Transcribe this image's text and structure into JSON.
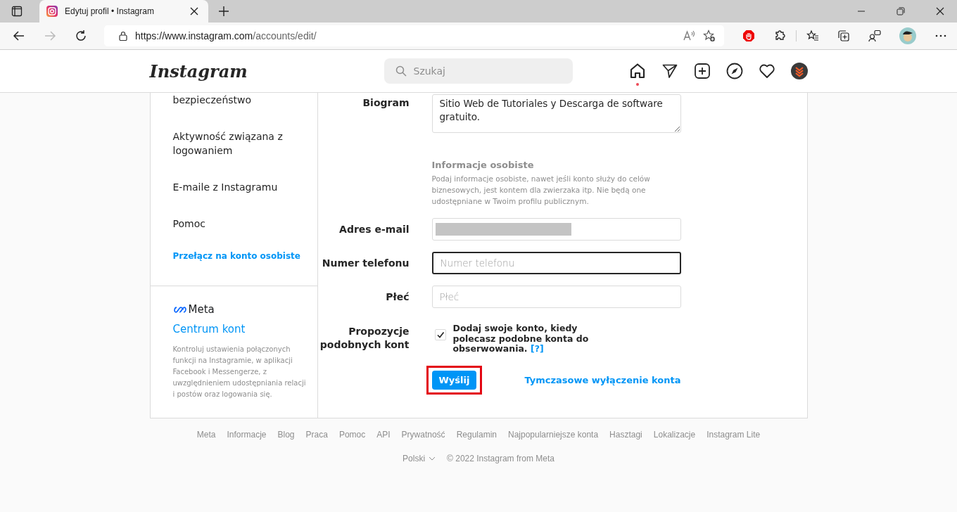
{
  "browser": {
    "tab_title": "Edytuj profil • Instagram",
    "url_host": "https://www.instagram.com",
    "url_path": "/accounts/edit/"
  },
  "header": {
    "logo": "Instagram",
    "search": {
      "placeholder": "Szukaj"
    },
    "nav": [
      {
        "kind": "home",
        "selected": true
      },
      {
        "kind": "send",
        "selected": false
      },
      {
        "kind": "create",
        "selected": false
      },
      {
        "kind": "explore",
        "selected": false
      },
      {
        "kind": "activity",
        "selected": false
      },
      {
        "kind": "profile",
        "selected": false
      }
    ]
  },
  "sidebar": {
    "items": [
      {
        "label": "bezpieczeństwo",
        "kind": "item"
      },
      {
        "label": "Aktywność związana z logowaniem",
        "kind": "item"
      },
      {
        "label": "E-maile z Instagramu",
        "kind": "item"
      },
      {
        "label": "Pomoc",
        "kind": "item"
      },
      {
        "label": "Przełącz na konto osobiste",
        "kind": "link"
      }
    ],
    "meta": {
      "logo": "Meta",
      "title": "Centrum kont",
      "description": "Kontroluj ustawienia połączonych funkcji na Instagramie, w aplikacji Facebook i Messengerze, z uwzględnieniem udostępniania relacji i postów oraz logowania się."
    }
  },
  "form": {
    "bio": {
      "label": "Biogram",
      "value": "Sitio Web de Tutoriales y Descarga de software gratuito."
    },
    "personal_info": {
      "title": "Informacje osobiste",
      "description": "Podaj informacje osobiste, nawet jeśli konto służy do celów biznesowych, jest kontem dla zwierzaka itp. Nie będą one udostępniane w Twoim profilu publicznym."
    },
    "fields": [
      {
        "label": "Adres e-mail",
        "redacted": true,
        "focused": false
      },
      {
        "label": "Numer telefonu",
        "placeholder": "Numer telefonu",
        "redacted": false,
        "focused": true
      },
      {
        "label": "Płeć",
        "placeholder": "Płeć",
        "redacted": false,
        "focused": false
      }
    ],
    "suggestions": {
      "label": "Propozycje podobnych kont",
      "text": "Dodaj swoje konto, kiedy polecasz podobne konta do obserwowania.",
      "help": "[?]",
      "checked": true
    },
    "submit": {
      "label": "Wyślij",
      "highlighted": true
    },
    "deactivate": "Tymczasowe wyłączenie konta"
  },
  "footer": {
    "links": [
      "Meta",
      "Informacje",
      "Blog",
      "Praca",
      "Pomoc",
      "API",
      "Prywatność",
      "Regulamin",
      "Najpopularniejsze konta",
      "Hasztagi",
      "Lokalizacje",
      "Instagram Lite"
    ],
    "language": "Polski",
    "copyright": "© 2022 Instagram from Meta"
  }
}
